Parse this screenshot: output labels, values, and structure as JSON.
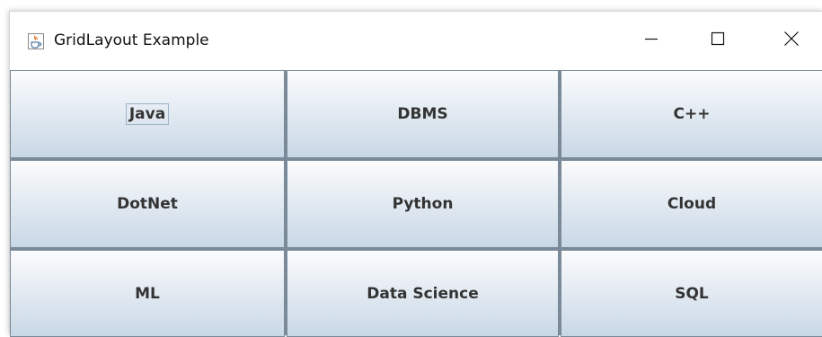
{
  "window": {
    "title": "GridLayout Example",
    "app_icon": "java-cup-icon",
    "controls": {
      "minimize_icon": "minimize-icon",
      "maximize_icon": "maximize-icon",
      "close_icon": "close-icon"
    }
  },
  "grid": {
    "rows": 3,
    "columns": 3,
    "focused_button": "Java",
    "buttons": [
      {
        "label": "Java"
      },
      {
        "label": "DBMS"
      },
      {
        "label": "C++"
      },
      {
        "label": "DotNet"
      },
      {
        "label": "Python"
      },
      {
        "label": "Cloud"
      },
      {
        "label": "ML"
      },
      {
        "label": "Data Science"
      },
      {
        "label": "SQL"
      }
    ]
  },
  "colors": {
    "button_gradient_top": "#fbfcfd",
    "button_gradient_bottom": "#c9d8e6",
    "grid_border": "#7a8a99",
    "focus_border": "#9fb3c8",
    "button_text": "#333333"
  }
}
